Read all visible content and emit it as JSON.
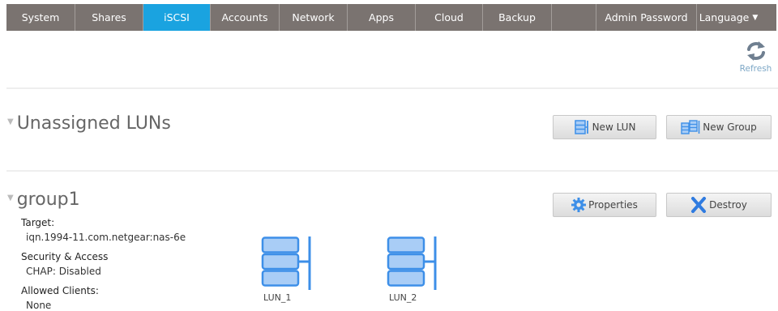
{
  "nav": {
    "tabs": [
      {
        "label": "System"
      },
      {
        "label": "Shares"
      },
      {
        "label": "iSCSI"
      },
      {
        "label": "Accounts"
      },
      {
        "label": "Network"
      },
      {
        "label": "Apps"
      },
      {
        "label": "Cloud"
      },
      {
        "label": "Backup"
      },
      {
        "label": ""
      },
      {
        "label": "Admin Password"
      },
      {
        "label": "Language"
      }
    ],
    "active_tab": "iSCSI",
    "language_caret": "▼"
  },
  "toolbar": {
    "refresh_label": "Refresh",
    "refresh_icon": "refresh-icon"
  },
  "unassigned": {
    "title": "Unassigned LUNs",
    "collapse_icon": "triangle-down-icon",
    "new_lun_label": "New LUN",
    "new_lun_icon": "lun-icon",
    "new_group_label": "New Group",
    "new_group_icon": "group-icon"
  },
  "group": {
    "title": "group1",
    "properties_label": "Properties",
    "properties_icon": "gear-icon",
    "destroy_label": "Destroy",
    "destroy_icon": "x-icon",
    "target_label": "Target:",
    "target_value": "iqn.1994-11.com.netgear:nas-6e",
    "security_label": "Security & Access",
    "security_value": "CHAP: Disabled",
    "clients_label": "Allowed Clients:",
    "clients_value": "None",
    "luns": [
      {
        "name": "LUN_1",
        "icon": "disk-stack-icon"
      },
      {
        "name": "LUN_2",
        "icon": "disk-stack-icon"
      }
    ]
  },
  "colors": {
    "nav_bg": "#7a7370",
    "nav_active": "#1aa3e0",
    "lun_blue": "#3d8fe8",
    "lun_fill": "#a9cdf6"
  }
}
